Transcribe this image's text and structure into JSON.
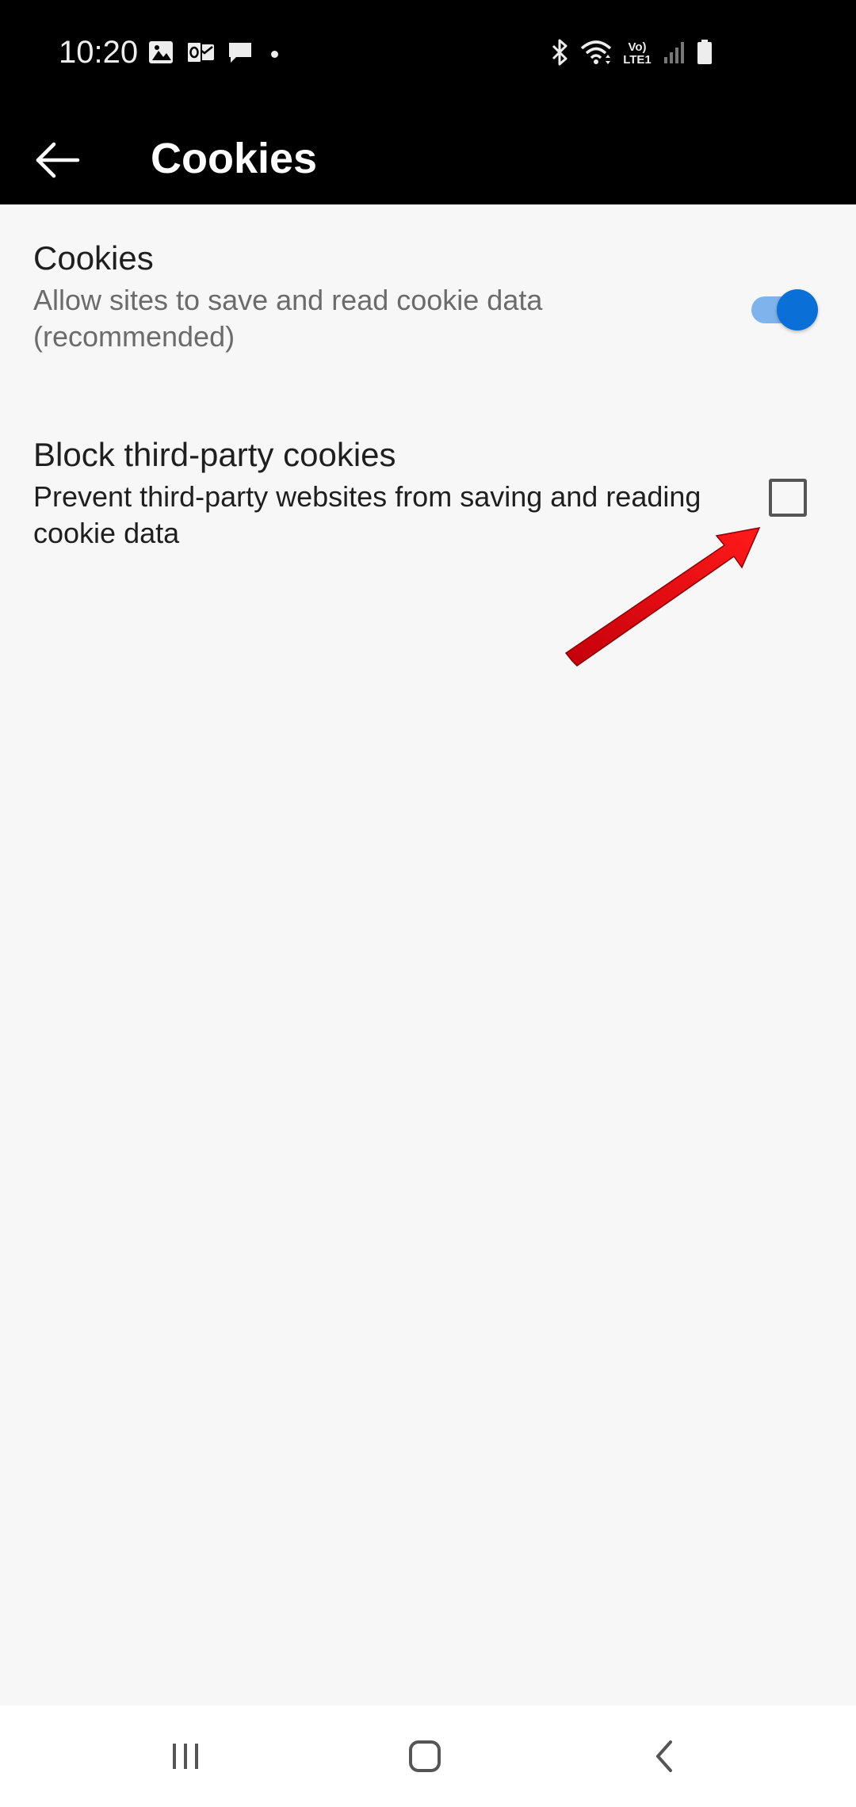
{
  "status_bar": {
    "time": "10:20",
    "left_icons": [
      "gallery-icon",
      "outlook-icon",
      "message-icon",
      "dot-icon"
    ],
    "right_icons": [
      "bluetooth-icon",
      "wifi-icon",
      "volte-lte-icon",
      "signal-icon",
      "battery-icon"
    ],
    "volte_label": "Vo) LTE1"
  },
  "app_bar": {
    "back_icon": "back-arrow-icon",
    "title": "Cookies"
  },
  "settings": {
    "cookies": {
      "title": "Cookies",
      "description": "Allow sites to save and read cookie data (recommended)",
      "toggle_on": true,
      "accent_color": "#0a6fd6"
    },
    "third_party": {
      "title": "Block third-party cookies",
      "description": "Prevent third-party websites from saving and reading cookie data",
      "checked": false
    }
  },
  "annotation": {
    "icon": "red-arrow-icon",
    "color": "#e8000b"
  },
  "nav_bar": {
    "icons": [
      "recents-icon",
      "home-icon",
      "back-icon"
    ]
  }
}
